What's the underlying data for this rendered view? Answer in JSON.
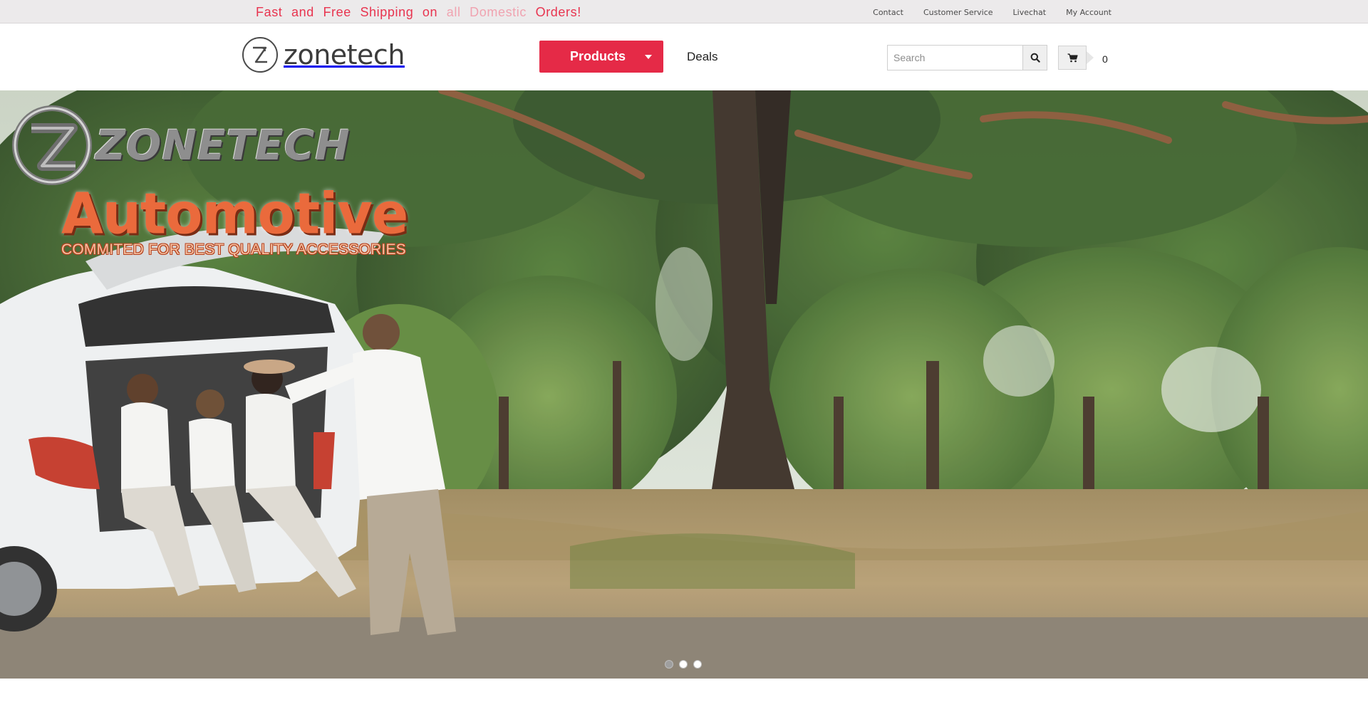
{
  "topbar": {
    "promo_main": "Fast and Free Shipping on",
    "promo_faded": "all Domestic",
    "promo_end": "Orders!",
    "links": [
      "Contact",
      "Customer Service",
      "Livechat",
      "My Account"
    ]
  },
  "header": {
    "logo_text": "zonetech",
    "products_label": "Products",
    "deals_label": "Deals",
    "search_placeholder": "Search",
    "cart_count": "0"
  },
  "hero": {
    "brand_text": "ZONETECH",
    "headline": "Automotive",
    "subline": "COMMITED FOR BEST QUALITY ACCESSORIES",
    "slides": 3,
    "active_slide": 1
  },
  "colors": {
    "accent": "#e52a47",
    "topbar_bg": "#eceaeb",
    "headline": "#ea6a3c"
  },
  "icons": {
    "search": "search-icon",
    "cart": "cart-icon",
    "caret": "caret-down-icon"
  }
}
